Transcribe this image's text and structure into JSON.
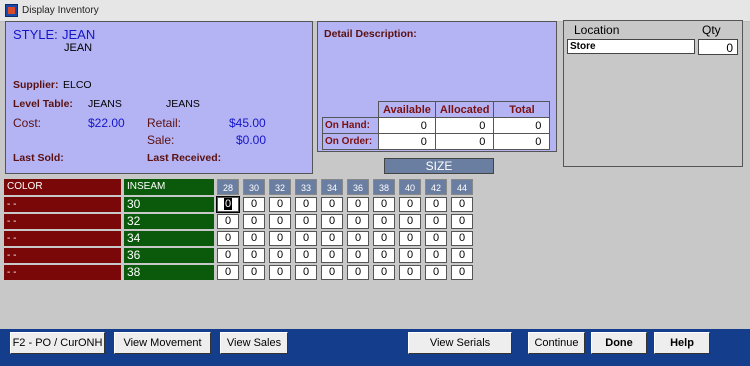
{
  "window": {
    "title": "Display Inventory"
  },
  "style_panel": {
    "style_label": "STYLE:",
    "style_value": "JEAN",
    "description": "JEAN",
    "supplier_label": "Supplier:",
    "supplier_value": "ELCO",
    "level_table_label": "Level Table:",
    "level_value_1": "JEANS",
    "level_value_2": "JEANS",
    "cost_label": "Cost:",
    "cost_value": "$22.00",
    "retail_label": "Retail:",
    "retail_value": "$45.00",
    "sale_label": "Sale:",
    "sale_value": "$0.00",
    "last_sold_label": "Last Sold:",
    "last_received_label": "Last Received:"
  },
  "detail_panel": {
    "title": "Detail Description:",
    "columns": [
      "Available",
      "Allocated",
      "Total"
    ],
    "rows": [
      {
        "label": "On Hand:",
        "values": [
          "0",
          "0",
          "0"
        ]
      },
      {
        "label": "On Order:",
        "values": [
          "0",
          "0",
          "0"
        ]
      }
    ]
  },
  "location_panel": {
    "location_header": "Location",
    "qty_header": "Qty",
    "store_label": "Store",
    "store_qty": "0"
  },
  "grid": {
    "size_label": "SIZE",
    "color_header": "COLOR",
    "inseam_header": "INSEAM",
    "sizes": [
      "28",
      "30",
      "32",
      "33",
      "34",
      "36",
      "38",
      "40",
      "42",
      "44"
    ],
    "rows": [
      {
        "color": "- -",
        "inseam": "30",
        "values": [
          "0",
          "0",
          "0",
          "0",
          "0",
          "0",
          "0",
          "0",
          "0",
          "0"
        ]
      },
      {
        "color": "- -",
        "inseam": "32",
        "values": [
          "0",
          "0",
          "0",
          "0",
          "0",
          "0",
          "0",
          "0",
          "0",
          "0"
        ]
      },
      {
        "color": "- -",
        "inseam": "34",
        "values": [
          "0",
          "0",
          "0",
          "0",
          "0",
          "0",
          "0",
          "0",
          "0",
          "0"
        ]
      },
      {
        "color": "- -",
        "inseam": "36",
        "values": [
          "0",
          "0",
          "0",
          "0",
          "0",
          "0",
          "0",
          "0",
          "0",
          "0"
        ]
      },
      {
        "color": "- -",
        "inseam": "38",
        "values": [
          "0",
          "0",
          "0",
          "0",
          "0",
          "0",
          "0",
          "0",
          "0",
          "0"
        ]
      }
    ]
  },
  "footer": {
    "po_button": "F2 - PO / CurONH",
    "movement_button": "View Movement",
    "sales_button": "View Sales",
    "serials_button": "View Serials",
    "continue_button": "Continue",
    "done_button": "Done",
    "help_button": "Help"
  },
  "colors": {
    "panel_bg": "#b4b4f4",
    "color_col": "#7a0808",
    "inseam_col": "#0b5a0b",
    "size_header": "#6a7ea2",
    "footer_bar": "#143e8c"
  }
}
